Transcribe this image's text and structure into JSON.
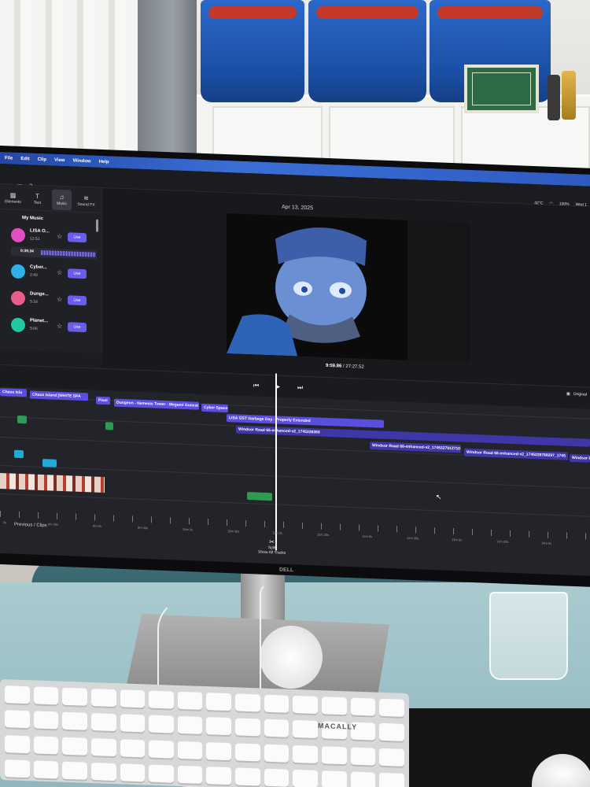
{
  "app": {
    "menu": [
      "File",
      "Edit",
      "Clip",
      "View",
      "Window",
      "Help"
    ],
    "status": {
      "temperature": "42°C",
      "battery": "100%",
      "clock": "Wed 1"
    }
  },
  "left_panel": {
    "tabs": [
      {
        "label": "Elements",
        "icon": "elements-icon"
      },
      {
        "label": "Text",
        "icon": "text-icon"
      },
      {
        "label": "Music",
        "icon": "music-note-icon"
      },
      {
        "label": "Sound FX",
        "icon": "waveform-icon"
      }
    ],
    "section_title": "My Music",
    "tracks": [
      {
        "name": "LISA O...",
        "duration": "12:51",
        "color": "#e04fc0"
      },
      {
        "name": "Cyber...",
        "duration": "2:40",
        "color": "#2fb0e8"
      },
      {
        "name": "Dunge...",
        "duration": "5:18",
        "color": "#e85d8c"
      },
      {
        "name": "Planet...",
        "duration": "5:06",
        "color": "#22c9a0"
      }
    ],
    "playing_time": "0:39.34",
    "use_label": "Use"
  },
  "preview": {
    "date": "Apr 13, 2025",
    "current_time": "9:59.86",
    "total_time": "27:27.52",
    "aspect": "Original"
  },
  "timeline": {
    "clips": [
      {
        "label": "Chaos Isla",
        "track": "music"
      },
      {
        "label": "Chaos Island [WHITE SPA",
        "track": "music"
      },
      {
        "label": "Pixel",
        "track": "music"
      },
      {
        "label": "Dungeon - Nemesis Tower - Megami Guncst",
        "track": "music"
      },
      {
        "label": "Cyber Space",
        "track": "music"
      },
      {
        "label": "LISA OST Garbage Day - Properly Extended",
        "track": "music"
      },
      {
        "label": "Windsor Road 65-enhanced-v2_1745326389",
        "track": "audio"
      },
      {
        "label": "Windsor Road 68-enhanced-v2_1745327912710",
        "track": "audio"
      },
      {
        "label": "Windsor Road 68-enhanced-v2_1745328788297_1745",
        "track": "audio"
      },
      {
        "label": "Windsor R",
        "track": "audio"
      }
    ],
    "ruler": [
      "0s",
      "6m 30s",
      "9m 0s",
      "9m 30s",
      "10m 0s",
      "10m 30s",
      "11m 0s",
      "11m 30s",
      "12m 0s",
      "12m 30s",
      "13m 0s",
      "13m 30s",
      "14m 0s"
    ],
    "split_label": "Split",
    "previous_label": "Previous / Clips",
    "show_all": "Show All Tracks"
  },
  "monitor_brand": "DELL",
  "keyboard_brand": "MACALLY"
}
